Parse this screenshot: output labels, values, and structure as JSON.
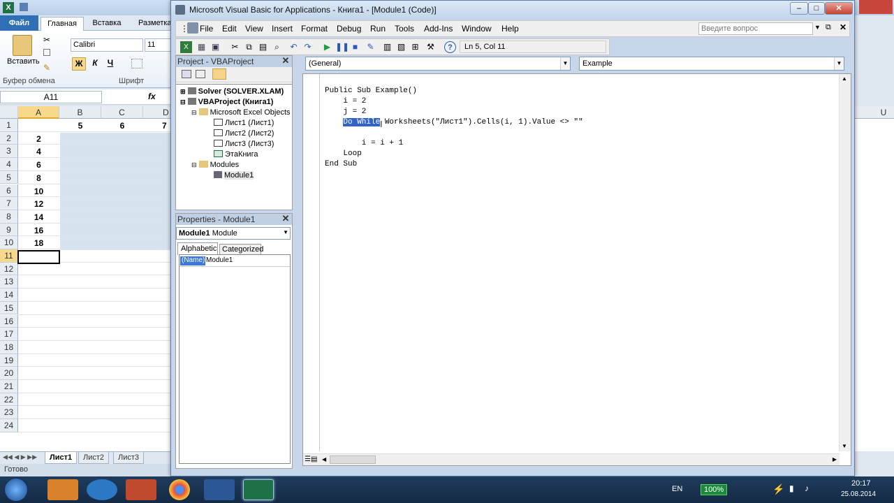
{
  "excel": {
    "file_tab": "Файл",
    "tabs": [
      "Главная",
      "Вставка",
      "Разметка"
    ],
    "paste_label": "Вставить",
    "font_name": "Calibri",
    "font_size": "11",
    "bold": "Ж",
    "italic": "К",
    "underline": "Ч",
    "group_clipboard": "Буфер обмена",
    "group_font": "Шрифт",
    "name_box": "A11",
    "fx": "fx",
    "columns": [
      "A",
      "B",
      "C",
      "D"
    ],
    "rows": [
      "1",
      "2",
      "3",
      "4",
      "5",
      "6",
      "7",
      "8",
      "9",
      "10",
      "11",
      "12",
      "13",
      "14",
      "15",
      "16",
      "17",
      "18",
      "19",
      "20",
      "21",
      "22",
      "23",
      "24"
    ],
    "row1": [
      "",
      "5",
      "6",
      "7"
    ],
    "colA": [
      "",
      "2",
      "4",
      "6",
      "8",
      "10",
      "12",
      "14",
      "16",
      "18"
    ],
    "sheets": [
      "Лист1",
      "Лист2",
      "Лист3"
    ],
    "status": "Готово",
    "right_col_header": "U"
  },
  "vbe": {
    "title": "Microsoft Visual Basic for Applications - Книга1 - [Module1 (Code)]",
    "menu": [
      "File",
      "Edit",
      "View",
      "Insert",
      "Format",
      "Debug",
      "Run",
      "Tools",
      "Add-Ins",
      "Window",
      "Help"
    ],
    "help_placeholder": "Введите вопрос",
    "position": "Ln 5, Col 11",
    "project": {
      "title": "Project - VBAProject",
      "items": [
        {
          "label": "Solver (SOLVER.XLAM)",
          "bold": true
        },
        {
          "label": "VBAProject (Книга1)",
          "bold": true
        },
        {
          "label": "Microsoft Excel Objects"
        },
        {
          "label": "Лист1 (Лист1)"
        },
        {
          "label": "Лист2 (Лист2)"
        },
        {
          "label": "Лист3 (Лист3)"
        },
        {
          "label": "ЭтаКнига"
        },
        {
          "label": "Modules"
        },
        {
          "label": "Module1"
        }
      ]
    },
    "properties": {
      "title": "Properties - Module1",
      "object_name": "Module1",
      "object_type": "Module",
      "tab_alpha": "Alphabetic",
      "tab_cat": "Categorized",
      "prop_key": "(Name)",
      "prop_val": "Module1"
    },
    "code": {
      "object_combo": "(General)",
      "proc_combo": "Example",
      "lines": [
        "Public Sub Example()",
        "    i = 2",
        "    j = 2",
        "    Do While Worksheets(\"Лист1\").Cells(i, 1).Value <> \"\"",
        "",
        "        i = i + 1",
        "    Loop",
        "End Sub"
      ],
      "line4_selected": "Do While",
      "line4_rest": " Worksheets(\"Лист1\").Cells(i, 1).Value <> \"\""
    }
  },
  "taskbar": {
    "lang": "EN",
    "battery": "100%",
    "time": "20:17",
    "date": "25.08.2014"
  }
}
